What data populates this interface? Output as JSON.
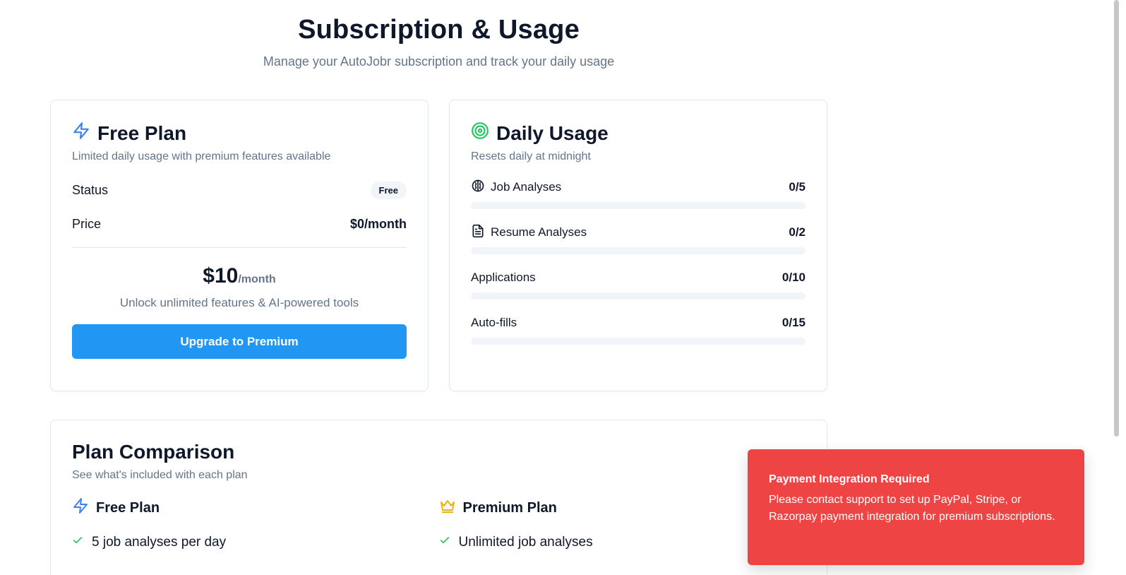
{
  "header": {
    "title": "Subscription & Usage",
    "subtitle": "Manage your AutoJobr subscription and track your daily usage"
  },
  "plan_card": {
    "icon": "zap-icon",
    "title": "Free Plan",
    "subtitle": "Limited daily usage with premium features available",
    "status_label": "Status",
    "status_badge": "Free",
    "price_label": "Price",
    "price_value": "$0/month",
    "upsell_amount": "$10",
    "upsell_period": "/month",
    "upsell_desc": "Unlock unlimited features & AI-powered tools",
    "upgrade_button": "Upgrade to Premium"
  },
  "usage_card": {
    "icon": "target-icon",
    "title": "Daily Usage",
    "subtitle": "Resets daily at midnight",
    "items": [
      {
        "label": "Job Analyses",
        "count": "0/5",
        "icon": "brain-icon",
        "used": 0,
        "limit": 5
      },
      {
        "label": "Resume Analyses",
        "count": "0/2",
        "icon": "file-text-icon",
        "used": 0,
        "limit": 2
      },
      {
        "label": "Applications",
        "count": "0/10",
        "icon": "",
        "used": 0,
        "limit": 10
      },
      {
        "label": "Auto-fills",
        "count": "0/15",
        "icon": "",
        "used": 0,
        "limit": 15
      }
    ]
  },
  "comparison": {
    "title": "Plan Comparison",
    "subtitle": "See what's included with each plan",
    "free": {
      "title": "Free Plan",
      "icon": "zap-icon",
      "features": [
        "5 job analyses per day"
      ]
    },
    "premium": {
      "title": "Premium Plan",
      "icon": "crown-icon",
      "features": [
        "Unlimited job analyses"
      ]
    }
  },
  "toast": {
    "title": "Payment Integration Required",
    "body": "Please contact support to set up PayPal, Stripe, or Razorpay payment integration for premium subscriptions."
  },
  "colors": {
    "accent": "#2196f3",
    "zap": "#3b82f6",
    "target": "#22c55e",
    "crown": "#eab308",
    "check": "#22c55e",
    "toast_bg": "#ef4444"
  }
}
